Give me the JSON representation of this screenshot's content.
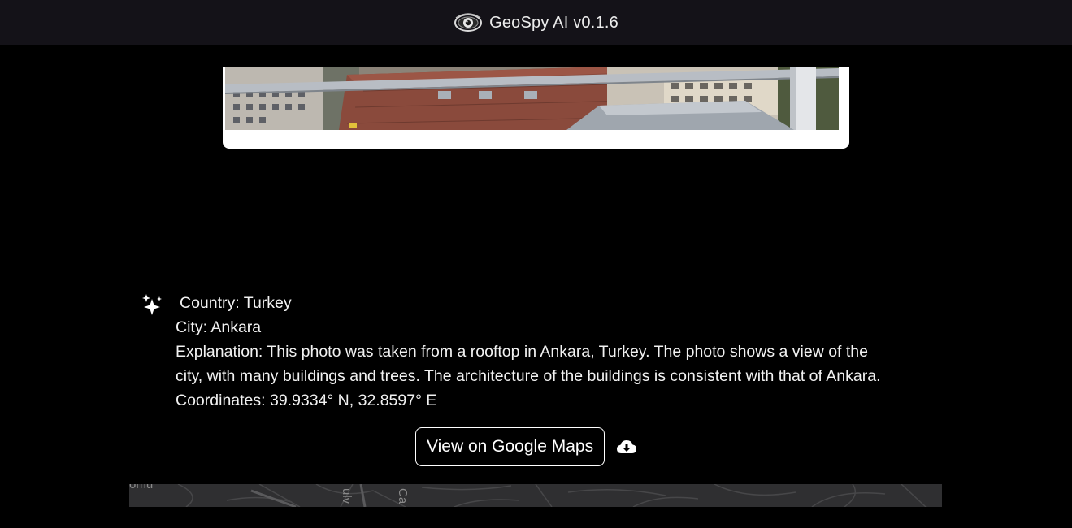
{
  "header": {
    "title": "GeoSpy AI v0.1.6",
    "logo_icon": "eye-icon"
  },
  "photo": {
    "icon": "uploaded-rooftop-photo"
  },
  "result": {
    "icon": "sparkle-icon",
    "country": "Country: Turkey",
    "city": "City: Ankara",
    "explanation_line1": "Explanation: This photo was taken from a rooftop in Ankara, Turkey. The photo shows a view of the",
    "explanation_line2": "city, with many buildings and trees. The architecture of the buildings is consistent with that of Ankara.",
    "coordinates": "Coordinates: 39.9334° N, 32.8597° E"
  },
  "actions": {
    "maps_button_label": "View on Google Maps",
    "download_icon": "cloud-download-icon"
  },
  "map": {
    "label_1": "ömü",
    "label_2": "ulv",
    "label_3": "Ca"
  },
  "colors": {
    "header_bg": "#141218",
    "page_bg": "#000000",
    "text": "#ffffff",
    "map_bg": "#2f2f31"
  }
}
